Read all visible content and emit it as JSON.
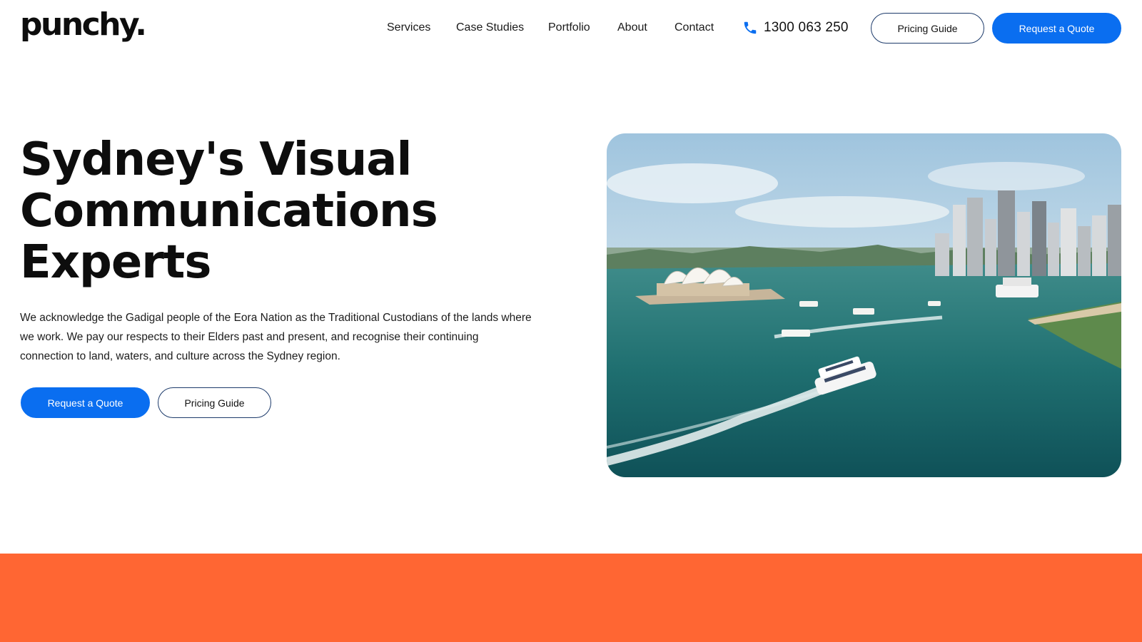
{
  "brand": {
    "logo": "punchy."
  },
  "nav": {
    "items": [
      "Services",
      "Case Studies",
      "Portfolio",
      "About",
      "Contact"
    ],
    "phone": "1300 063 250",
    "pricing_label": "Pricing Guide",
    "quote_label": "Request a Quote"
  },
  "hero": {
    "title_lines": [
      "Sydney's Visual",
      "Communications",
      "Experts"
    ],
    "body": "We acknowledge the Gadigal people of the Eora Nation as the Traditional Custodians of the lands where we work. We pay our respects to their Elders past and present, and recognise their continuing connection to land, waters, and culture across the Sydney region.",
    "primary_cta": "Request a Quote",
    "secondary_cta": "Pricing Guide"
  },
  "colors": {
    "accent": "#0a6ef0",
    "band": "#ff6633",
    "outline": "#1d3b6b",
    "text": "#0d0d0d"
  },
  "icons": {
    "phone": "phone-icon"
  }
}
